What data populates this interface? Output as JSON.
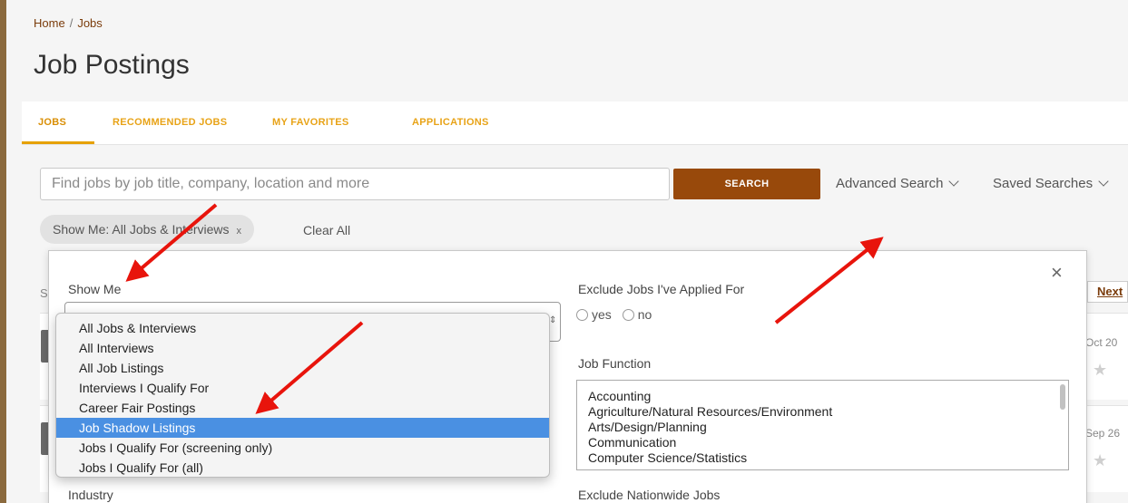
{
  "breadcrumb": {
    "home": "Home",
    "separator": "/",
    "current": "Jobs"
  },
  "page_title": "Job Postings",
  "tabs": [
    {
      "label": "JOBS",
      "active": true
    },
    {
      "label": "RECOMMENDED JOBS",
      "active": false
    },
    {
      "label": "MY FAVORITES",
      "active": false
    },
    {
      "label": "APPLICATIONS",
      "active": false
    }
  ],
  "search": {
    "placeholder": "Find jobs by job title, company, location and more",
    "button_label": "SEARCH",
    "advanced_label": "Advanced Search",
    "saved_label": "Saved Searches"
  },
  "filters": {
    "chip_label": "Show Me: All Jobs & Interviews",
    "chip_remove": "x",
    "clear_all": "Clear All"
  },
  "background_list": {
    "partial_label": "S",
    "next_label": "Next",
    "card_dates": [
      "Oct 20",
      "Sep 26"
    ],
    "star_icon": "★"
  },
  "modal": {
    "close_icon": "×",
    "show_me_label": "Show Me",
    "exclude_applied_label": "Exclude Jobs I've Applied For",
    "yes_label": "yes",
    "no_label": "no",
    "job_function_label": "Job Function",
    "job_function_options": [
      "Accounting",
      "Agriculture/Natural Resources/Environment",
      "Arts/Design/Planning",
      "Communication",
      "Computer Science/Statistics"
    ],
    "industry_label": "Industry",
    "exclude_nationwide_label": "Exclude Nationwide Jobs"
  },
  "show_me_dropdown": {
    "options": [
      "All Jobs & Interviews",
      "All Interviews",
      "All Job Listings",
      "Interviews I Qualify For",
      "Career Fair Postings",
      "Job Shadow Listings",
      "Jobs I Qualify For (screening only)",
      "Jobs I Qualify For (all)"
    ],
    "highlighted": "Job Shadow Listings"
  },
  "colors": {
    "accent": "#e6a100",
    "brand": "#98490b",
    "highlight": "#4a90e2",
    "annotation_arrow": "#e8140c"
  }
}
